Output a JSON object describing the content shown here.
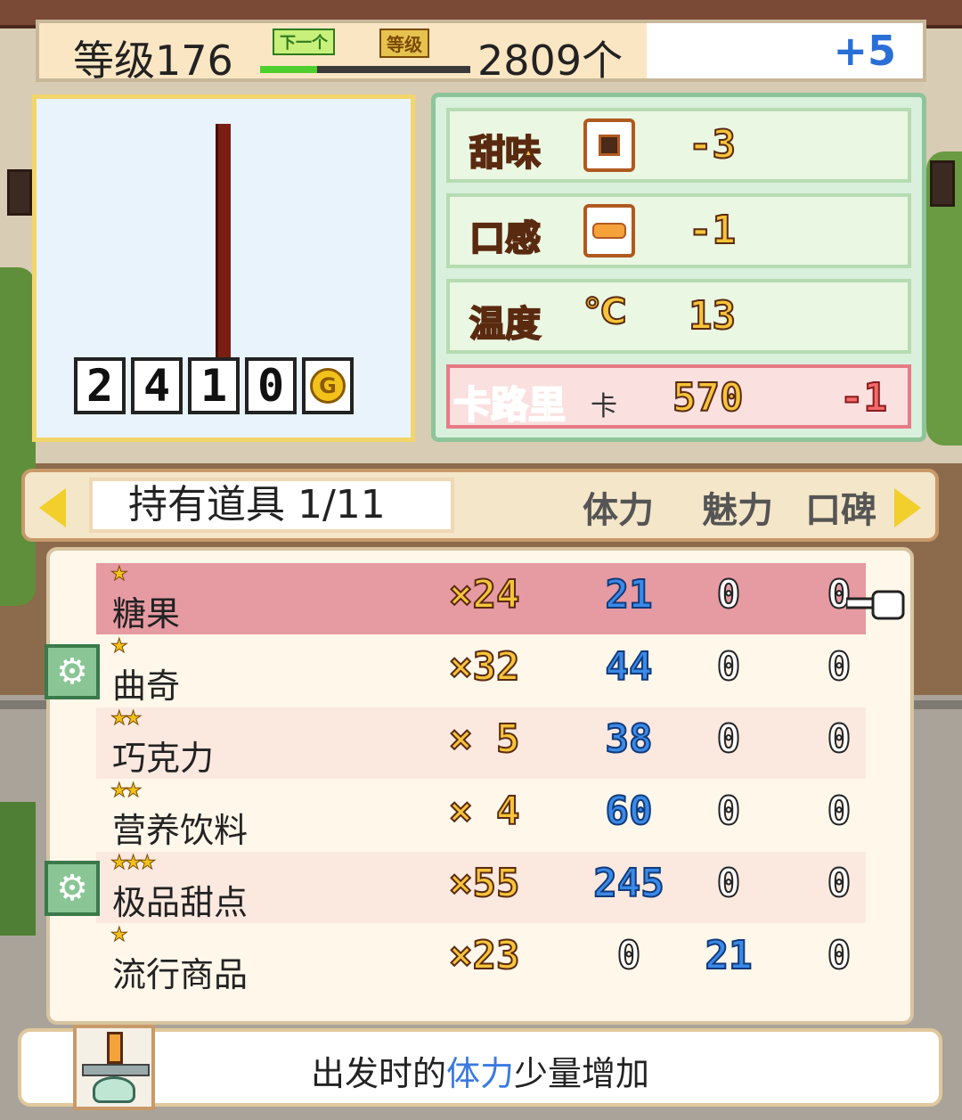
{
  "header": {
    "level_text": "等级176",
    "next_label": "下一个",
    "grade_label": "等级",
    "exp_progress": 0.27,
    "count_text": "2809个",
    "bonus_text": "+5"
  },
  "preview": {
    "price_digits": [
      "2",
      "4",
      "1",
      "0"
    ],
    "currency_symbol": "G"
  },
  "stats": {
    "sweetness": {
      "label": "甜味",
      "value": "-3"
    },
    "texture": {
      "label": "口感",
      "value": "-1"
    },
    "temperature": {
      "label": "温度",
      "symbol": "℃",
      "value": "13"
    },
    "calories": {
      "label": "卡路里",
      "unit": "卡",
      "value": "570",
      "change": "-1"
    }
  },
  "inventory": {
    "tab_label": "持有道具 1/11",
    "columns": [
      "体力",
      "魅力",
      "口碑"
    ],
    "items": [
      {
        "stars": "★",
        "name": "糖果",
        "qty": "×24",
        "stamina": "21",
        "charm": "0",
        "reputation": "0",
        "selected": true,
        "gear": false
      },
      {
        "stars": "★",
        "name": "曲奇",
        "qty": "×32",
        "stamina": "44",
        "charm": "0",
        "reputation": "0",
        "selected": false,
        "gear": true
      },
      {
        "stars": "★★",
        "name": "巧克力",
        "qty": "× 5",
        "stamina": "38",
        "charm": "0",
        "reputation": "0",
        "selected": false,
        "gear": false
      },
      {
        "stars": "★★",
        "name": "营养饮料",
        "qty": "× 4",
        "stamina": "60",
        "charm": "0",
        "reputation": "0",
        "selected": false,
        "gear": false
      },
      {
        "stars": "★★★",
        "name": "极品甜点",
        "qty": "×55",
        "stamina": "245",
        "charm": "0",
        "reputation": "0",
        "selected": false,
        "gear": true
      },
      {
        "stars": "★",
        "name": "流行商品",
        "qty": "×23",
        "stamina": "0",
        "charm": "21",
        "reputation": "0",
        "selected": false,
        "gear": false
      }
    ]
  },
  "description": {
    "prefix": "出发时的",
    "highlight": "体力",
    "suffix": "少量增加"
  },
  "colors": {
    "stamina_blue": "#3a8ae8",
    "selected_row": "#e69aa2",
    "calorie_red": "#e8323a"
  }
}
